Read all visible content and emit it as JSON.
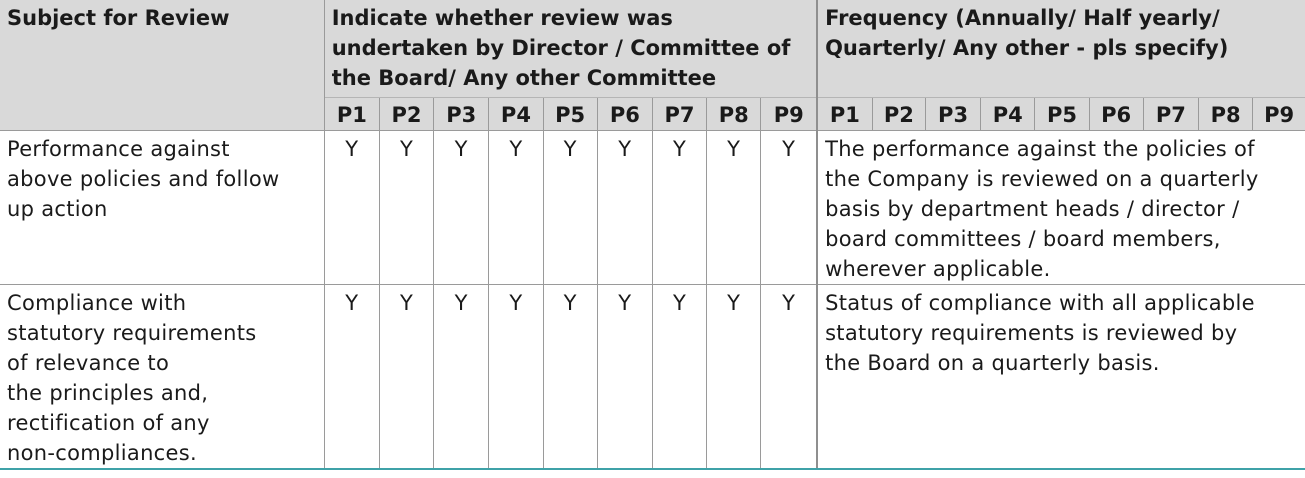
{
  "headers": {
    "subject": "Subject for Review",
    "review_group": "Indicate whether review was undertaken by Director / Committee of the Board/ Any other Committee",
    "frequency_group": "Frequency (Annually/ Half yearly/ Quarterly/ Any other - pls specify)",
    "principles": [
      "P1",
      "P2",
      "P3",
      "P4",
      "P5",
      "P6",
      "P7",
      "P8",
      "P9"
    ]
  },
  "rows": [
    {
      "subject_lines": [
        "Performance against",
        "above policies and follow",
        "up action"
      ],
      "marks": [
        "Y",
        "Y",
        "Y",
        "Y",
        "Y",
        "Y",
        "Y",
        "Y",
        "Y"
      ],
      "frequency_lines": [
        "The performance against the policies of",
        "the Company is reviewed on a quarterly",
        "basis by department heads / director /",
        "board committees / board members,",
        "wherever applicable."
      ]
    },
    {
      "subject_lines": [
        "Compliance with",
        "statutory requirements",
        "of relevance to",
        "the principles and,",
        "rectification of any",
        "non-compliances."
      ],
      "marks": [
        "Y",
        "Y",
        "Y",
        "Y",
        "Y",
        "Y",
        "Y",
        "Y",
        "Y"
      ],
      "frequency_lines": [
        "Status of compliance with all applicable",
        "statutory requirements is reviewed by",
        "the Board on a quarterly basis."
      ]
    }
  ]
}
